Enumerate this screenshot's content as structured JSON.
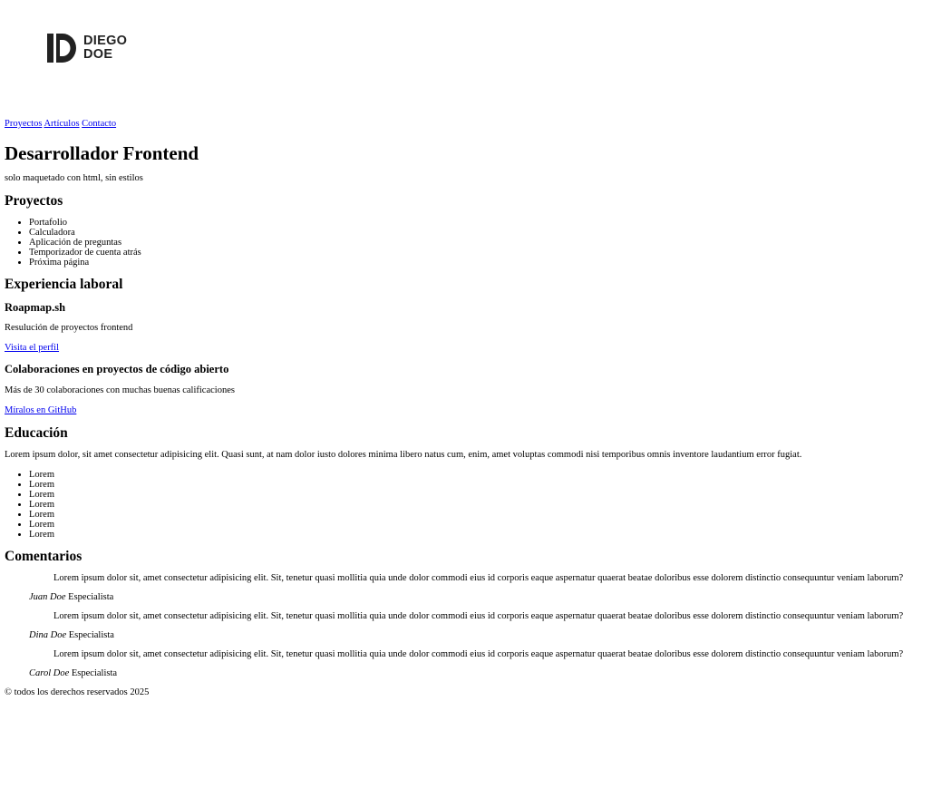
{
  "logo": {
    "line1": "DIEGO",
    "line2": "DOE"
  },
  "nav": {
    "links": [
      "Proyectos",
      "Artículos",
      "Contacto"
    ]
  },
  "hero": {
    "title": "Desarrollador Frontend",
    "subtitle": "solo maquetado con html, sin estilos"
  },
  "projects": {
    "heading": "Proyectos",
    "items": [
      "Portafolio",
      "Calculadora",
      "Aplicación de preguntas",
      "Temporizador de cuenta atrás",
      "Próxima página"
    ]
  },
  "experience": {
    "heading": "Experiencia laboral",
    "entries": [
      {
        "title": "Roapmap.sh",
        "description": "Resulución de proyectos frontend",
        "link": "Visita el perfil"
      },
      {
        "title": "Colaboraciones en proyectos de código abierto",
        "description": "Más de 30 colaboraciones con muchas buenas calificaciones",
        "link": "Míralos en GitHub"
      }
    ]
  },
  "education": {
    "heading": "Educación",
    "text": "Lorem ipsum dolor, sit amet consectetur adipisicing elit. Quasi sunt, at nam dolor iusto dolores minima libero natus cum, enim, amet voluptas commodi nisi temporibus omnis inventore laudantium error fugiat.",
    "items": [
      "Lorem",
      "Lorem",
      "Lorem",
      "Lorem",
      "Lorem",
      "Lorem",
      "Lorem"
    ]
  },
  "comments": {
    "heading": "Comentarios",
    "entries": [
      {
        "quote": "Lorem ipsum dolor sit, amet consectetur adipisicing elit. Sit, tenetur quasi mollitia quia unde dolor commodi eius id corporis eaque aspernatur quaerat beatae doloribus esse dolorem distinctio consequuntur veniam laborum?",
        "name": "Juan Doe",
        "role": "Especialista"
      },
      {
        "quote": "Lorem ipsum dolor sit, amet consectetur adipisicing elit. Sit, tenetur quasi mollitia quia unde dolor commodi eius id corporis eaque aspernatur quaerat beatae doloribus esse dolorem distinctio consequuntur veniam laborum?",
        "name": "Dina Doe",
        "role": "Especialista"
      },
      {
        "quote": "Lorem ipsum dolor sit, amet consectetur adipisicing elit. Sit, tenetur quasi mollitia quia unde dolor commodi eius id corporis eaque aspernatur quaerat beatae doloribus esse dolorem distinctio consequuntur veniam laborum?",
        "name": "Carol Doe",
        "role": "Especialista"
      }
    ]
  },
  "footer": {
    "text": "© todos los derechos reservados 2025"
  }
}
